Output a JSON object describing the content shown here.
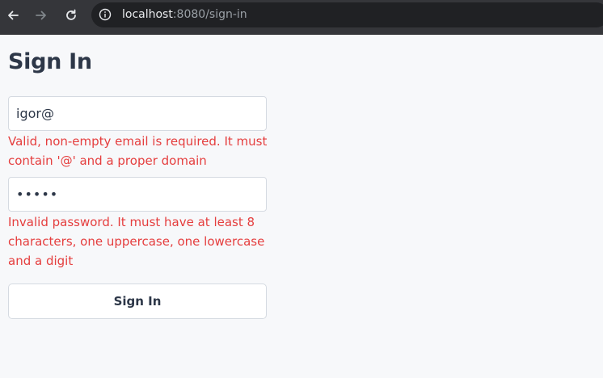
{
  "browser": {
    "url_host": "localhost",
    "url_rest": ":8080/sign-in",
    "icons": {
      "back": "back-arrow-icon",
      "forward": "forward-arrow-icon",
      "reload": "reload-icon",
      "info": "info-icon"
    }
  },
  "page": {
    "title": "Sign In",
    "email": {
      "value": "igor@",
      "error": "Valid, non-empty email is required. It must contain '@' and a proper domain"
    },
    "password": {
      "value": "•••••",
      "error": "Invalid password. It must have at least 8 characters, one uppercase, one lowercase and a digit"
    },
    "submit_label": "Sign In"
  },
  "colors": {
    "error": "#e53e3e",
    "text": "#2d3748",
    "background": "#f7f8fa",
    "chrome": "#35363a"
  }
}
